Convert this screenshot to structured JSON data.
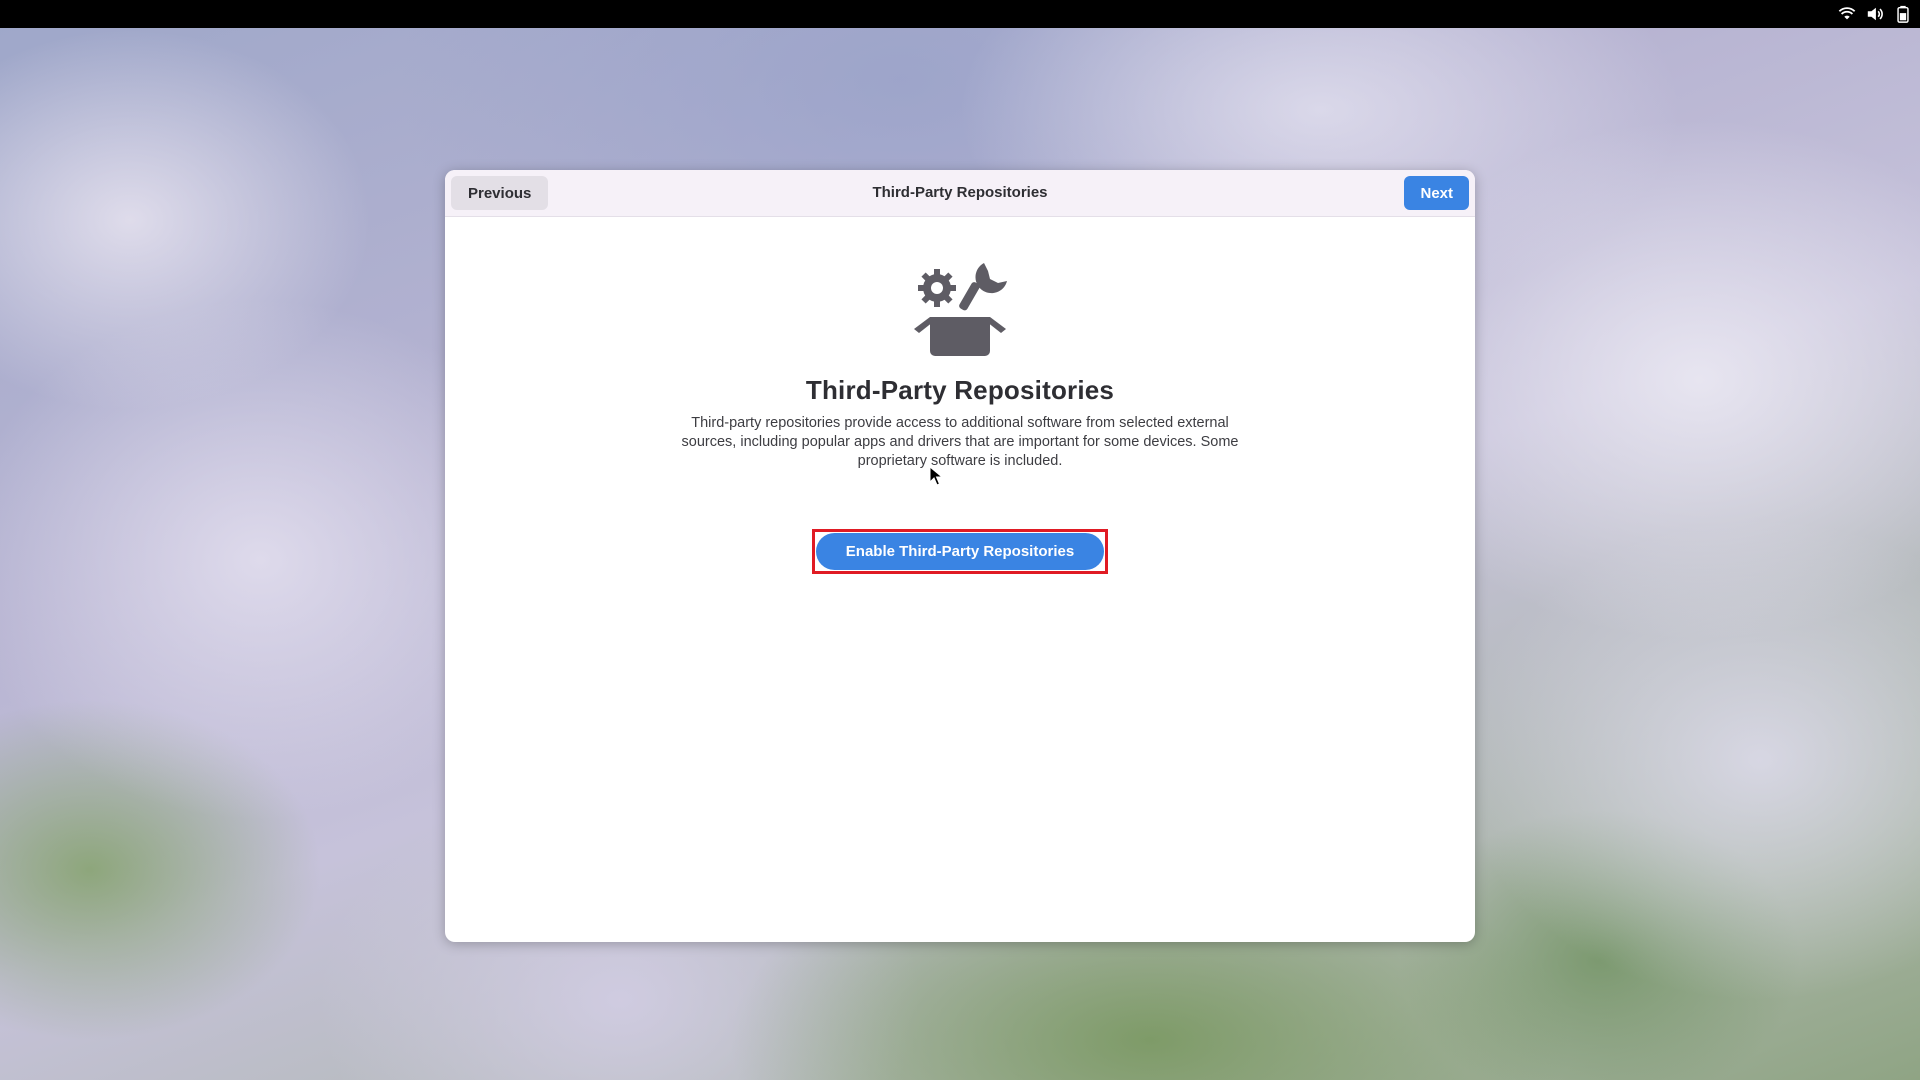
{
  "desktop": {
    "wallpaper": "clouds-wallpaper",
    "tray_icons": [
      "wifi-icon",
      "volume-icon",
      "battery-icon"
    ]
  },
  "dialog": {
    "header": {
      "previous_label": "Previous",
      "title": "Third-Party Repositories",
      "next_label": "Next"
    },
    "hero_icon": "software-tools-box-icon",
    "page_title": "Third-Party Repositories",
    "description": "Third-party repositories provide access to additional software from selected external sources, including popular apps and drivers that are important for some devices. Some proprietary software is included.",
    "enable_button_label": "Enable Third-Party Repositories"
  },
  "colors": {
    "accent": "#3a84e3",
    "highlight_box": "#e01b24",
    "topbar": "#000000",
    "icon_gray": "#5e5c64"
  }
}
